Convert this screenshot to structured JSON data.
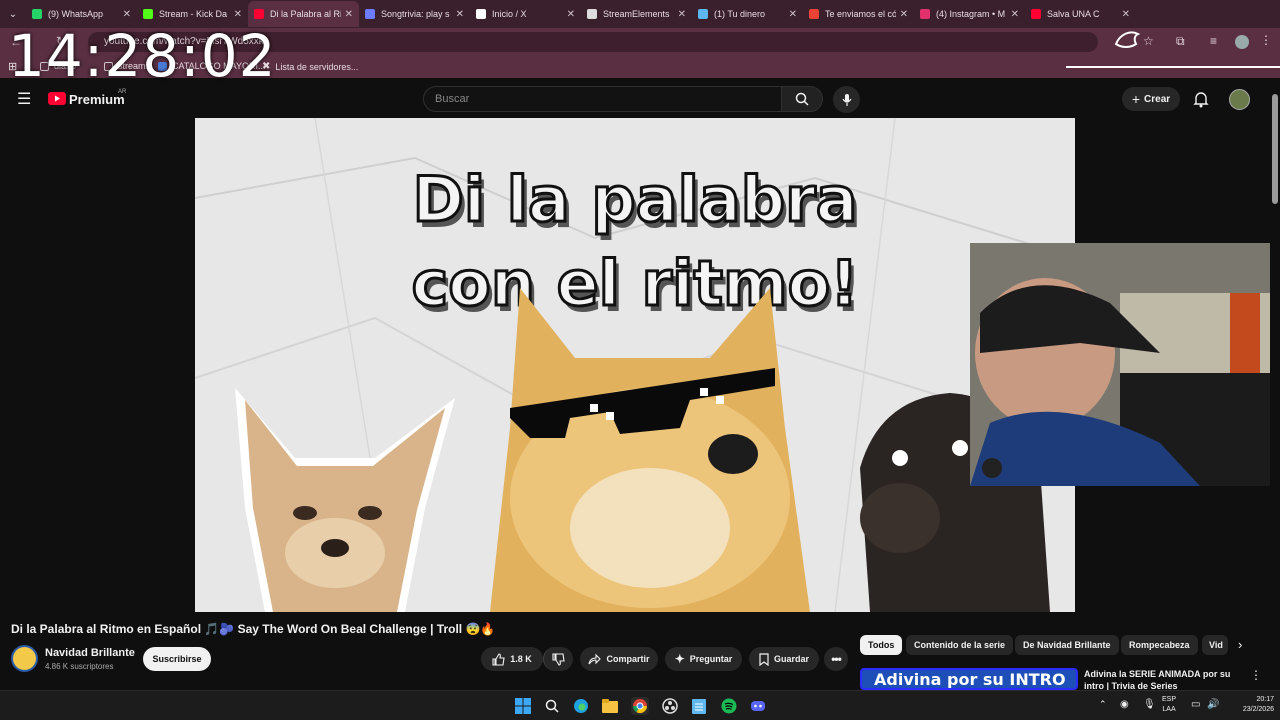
{
  "browser": {
    "tabs": [
      {
        "label": "(9) WhatsApp",
        "icon": "whatsapp-icon",
        "color": "#25d366"
      },
      {
        "label": "Stream - Kick Da",
        "icon": "kick-icon",
        "color": "#53fc18"
      },
      {
        "label": "Di la Palabra al Ri",
        "icon": "youtube-icon",
        "color": "#ff0033",
        "active": true
      },
      {
        "label": "Songtrivia: play s",
        "icon": "songtrivia-icon",
        "color": "#6b7cff"
      },
      {
        "label": "Inicio / X",
        "icon": "x-icon",
        "color": "#ffffff"
      },
      {
        "label": "StreamElements",
        "icon": "streamelements-icon",
        "color": "#dddddd"
      },
      {
        "label": "(1) Tu dinero",
        "icon": "mercadopago-icon",
        "color": "#5db8f0"
      },
      {
        "label": "Te enviamos el có",
        "icon": "gmail-icon",
        "color": "#ea4335"
      },
      {
        "label": "(4) Instagram • M",
        "icon": "instagram-icon",
        "color": "#e1306c"
      },
      {
        "label": "Salva UNA C",
        "icon": "youtube-icon",
        "color": "#ff0033"
      }
    ],
    "url": "youtube.com/watch?v=5isr7Wd5xxk",
    "bookmarks": [
      "diario",
      "streams",
      "CATALOGO MAYORI...",
      "Lista de servidores..."
    ]
  },
  "overlay": {
    "clock": "14:28:02"
  },
  "youtube": {
    "logo_text": "Premium",
    "country": "AR",
    "search_placeholder": "Buscar",
    "create_label": "Crear",
    "video_art_line1": "Di la palabra",
    "video_art_line2": "con el ritmo!",
    "video_title": "Di la Palabra al Ritmo en Español 🎵🫐 Say The Word On Beal Challenge | Troll 😨🔥",
    "channel_name": "Navidad Brillante",
    "channel_subs": "4.86 K suscriptores",
    "subscribe_label": "Suscribirse",
    "likes": "1.8 K",
    "share_label": "Compartir",
    "ask_label": "Preguntar",
    "save_label": "Guardar",
    "chips": [
      "Todos",
      "Contenido de la serie",
      "De Navidad Brillante",
      "Rompecabeza",
      "Vid"
    ],
    "rec_thumb_text": "Adivina por su INTRO",
    "rec_title": "Adivina la SERIE ANIMADA por su intro | Trivia de Series"
  },
  "taskbar": {
    "lang1": "ESP",
    "lang2": "LAA",
    "time": "20:17",
    "date": "23/2/2026"
  }
}
